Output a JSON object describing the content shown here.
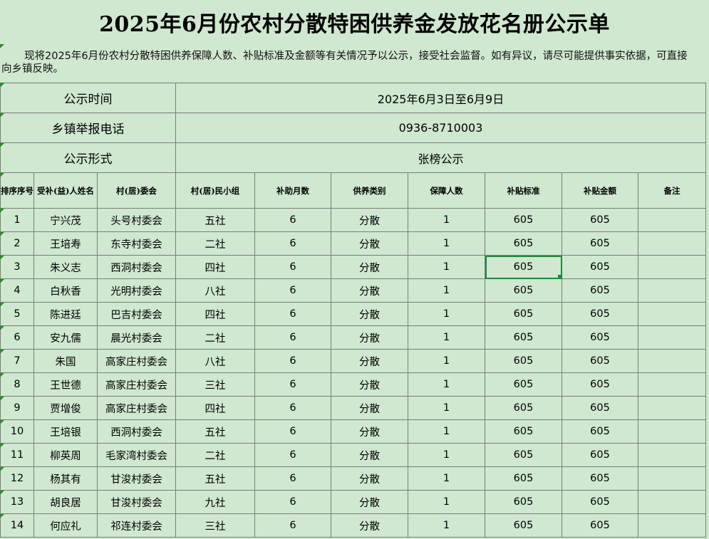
{
  "title": "2025年6月份农村分散特困供养金发放花名册公示单",
  "notice": "现将2025年6月份农村分散特困供养保障人数、补贴标准及金额等有关情况予以公示，接受社会监督。如有异议，请尽可能提供事实依据，可直接向乡镇反映。",
  "info": {
    "time_label": "公示时间",
    "time_value": "2025年6月3日至6月9日",
    "phone_label": "乡镇举报电话",
    "phone_value": "0936-8710003",
    "form_label": "公示形式",
    "form_value": "张榜公示"
  },
  "headers": {
    "seq": "排序序号",
    "name": "受补(益)人姓名",
    "village": "村(居)委会",
    "group": "村(居)民小组",
    "months": "补助月数",
    "type": "供养类别",
    "count": "保障人数",
    "standard": "补贴标准",
    "amount": "补贴金额",
    "remark": "备注"
  },
  "rows": [
    {
      "seq": "1",
      "name": "宁兴茂",
      "village": "头号村委会",
      "group": "五社",
      "months": "6",
      "type": "分散",
      "count": "1",
      "standard": "605",
      "amount": "605",
      "remark": ""
    },
    {
      "seq": "2",
      "name": "王培寿",
      "village": "东寺村委会",
      "group": "二社",
      "months": "6",
      "type": "分散",
      "count": "1",
      "standard": "605",
      "amount": "605",
      "remark": ""
    },
    {
      "seq": "3",
      "name": "朱义志",
      "village": "西洞村委会",
      "group": "四社",
      "months": "6",
      "type": "分散",
      "count": "1",
      "standard": "605",
      "amount": "605",
      "remark": ""
    },
    {
      "seq": "4",
      "name": "白秋香",
      "village": "光明村委会",
      "group": "八社",
      "months": "6",
      "type": "分散",
      "count": "1",
      "standard": "605",
      "amount": "605",
      "remark": ""
    },
    {
      "seq": "5",
      "name": "陈进廷",
      "village": "巴吉村委会",
      "group": "四社",
      "months": "6",
      "type": "分散",
      "count": "1",
      "standard": "605",
      "amount": "605",
      "remark": ""
    },
    {
      "seq": "6",
      "name": "安九儒",
      "village": "晨光村委会",
      "group": "二社",
      "months": "6",
      "type": "分散",
      "count": "1",
      "standard": "605",
      "amount": "605",
      "remark": ""
    },
    {
      "seq": "7",
      "name": "朱国",
      "village": "高家庄村委会",
      "group": "八社",
      "months": "6",
      "type": "分散",
      "count": "1",
      "standard": "605",
      "amount": "605",
      "remark": ""
    },
    {
      "seq": "8",
      "name": "王世德",
      "village": "高家庄村委会",
      "group": "三社",
      "months": "6",
      "type": "分散",
      "count": "1",
      "standard": "605",
      "amount": "605",
      "remark": ""
    },
    {
      "seq": "9",
      "name": "贾增俊",
      "village": "高家庄村委会",
      "group": "四社",
      "months": "6",
      "type": "分散",
      "count": "1",
      "standard": "605",
      "amount": "605",
      "remark": ""
    },
    {
      "seq": "10",
      "name": "王培银",
      "village": "西洞村委会",
      "group": "五社",
      "months": "6",
      "type": "分散",
      "count": "1",
      "standard": "605",
      "amount": "605",
      "remark": ""
    },
    {
      "seq": "11",
      "name": "柳英周",
      "village": "毛家湾村委会",
      "group": "二社",
      "months": "6",
      "type": "分散",
      "count": "1",
      "standard": "605",
      "amount": "605",
      "remark": ""
    },
    {
      "seq": "12",
      "name": "杨其有",
      "village": "甘浚村委会",
      "group": "五社",
      "months": "6",
      "type": "分散",
      "count": "1",
      "standard": "605",
      "amount": "605",
      "remark": ""
    },
    {
      "seq": "13",
      "name": "胡良居",
      "village": "甘浚村委会",
      "group": "九社",
      "months": "6",
      "type": "分散",
      "count": "1",
      "standard": "605",
      "amount": "605",
      "remark": ""
    },
    {
      "seq": "14",
      "name": "何应礼",
      "village": "祁连村委会",
      "group": "三社",
      "months": "6",
      "type": "分散",
      "count": "1",
      "standard": "605",
      "amount": "605",
      "remark": ""
    }
  ],
  "colors": {
    "background": "#cfe8cf",
    "grid": "#7b7b7b",
    "selection": "#1e8a3a"
  }
}
